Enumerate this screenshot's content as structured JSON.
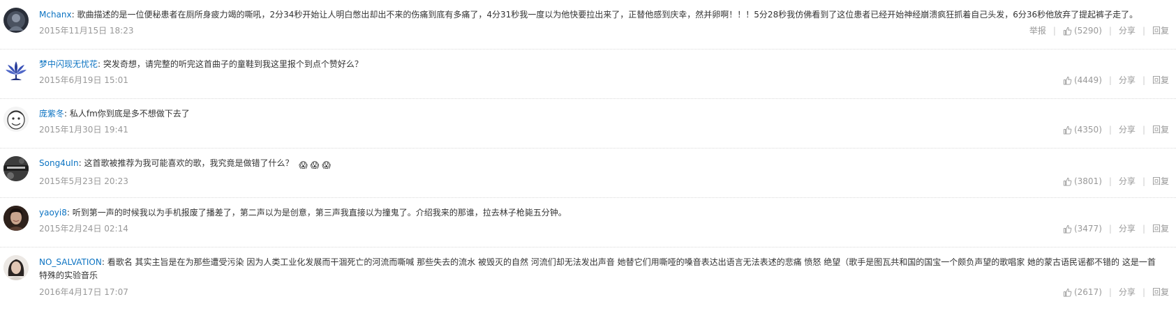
{
  "ui": {
    "report_label": "举报",
    "share_label": "分享",
    "reply_label": "回复"
  },
  "comments": [
    {
      "user": "Mchanx",
      "text": "歌曲描述的是一位便秘患者在厕所身疲力竭的嘶吼，2分34秒开始让人明白憋出却出不来的伤痛到底有多痛了，4分31秒我一度以为他快要拉出来了，正替他感到庆幸，然并卵啊！！！5分28秒我仿佛看到了这位患者已经开始神经崩溃疯狂抓着自己头发，6分36秒他放弃了提起裤子走了。",
      "time": "2015年11月15日 18:23",
      "likes": "(5290)",
      "show_report": true,
      "avatar_icon": "dark-figure-icon",
      "avatar_color": "#2a2f3a"
    },
    {
      "user": "梦中闪现无忧花",
      "text": "突发奇想，请完整的听完这首曲子的童鞋到我这里报个到点个赞好么？",
      "time": "2015年6月19日 15:01",
      "likes": "(4449)",
      "show_report": false,
      "avatar_icon": "lotus-flower-icon",
      "avatar_color": "#ffffff"
    },
    {
      "user": "庞紫冬",
      "text": "私人fm你到底是多不想做下去了",
      "time": "2015年1月30日 19:41",
      "likes": "(4350)",
      "show_report": false,
      "avatar_icon": "cartoon-face-icon",
      "avatar_color": "#f2f2f2"
    },
    {
      "user": "Song4uIn",
      "text": "这首歌被推荐为我可能喜欢的歌，我究竟是做错了什么？",
      "emojis": [
        "😱",
        "😱",
        "😱"
      ],
      "time": "2015年5月23日 20:23",
      "likes": "(3801)",
      "show_report": false,
      "avatar_icon": "monochrome-photo-icon",
      "avatar_color": "#444444"
    },
    {
      "user": "yaoyi8",
      "text": "听到第一声的时候我以为手机报废了播差了，第二声以为是创意，第三声我直接以为撞鬼了。介绍我来的那谁，拉去林子枪毙五分钟。",
      "time": "2015年2月24日 02:14",
      "likes": "(3477)",
      "show_report": false,
      "avatar_icon": "portrait-photo-icon",
      "avatar_color": "#3a2a22"
    },
    {
      "user": "NO_SALVATION",
      "text": "看歌名 其实主旨是在为那些遭受污染 因为人类工业化发展而干涸死亡的河流而嘶喊 那些失去的流水 被毁灭的自然 河流们却无法发出声音 她替它们用嘶哑的嗓音表达出语言无法表述的悲痛 愤怒 绝望（歌手是图瓦共和国的国宝一个颇负声望的歌唱家 她的蒙古语民谣都不错的 这是一首特殊的实验音乐",
      "time": "2016年4月17日 17:07",
      "likes": "(2617)",
      "show_report": false,
      "avatar_icon": "woman-portrait-icon",
      "avatar_color": "#e8e4e0"
    }
  ]
}
